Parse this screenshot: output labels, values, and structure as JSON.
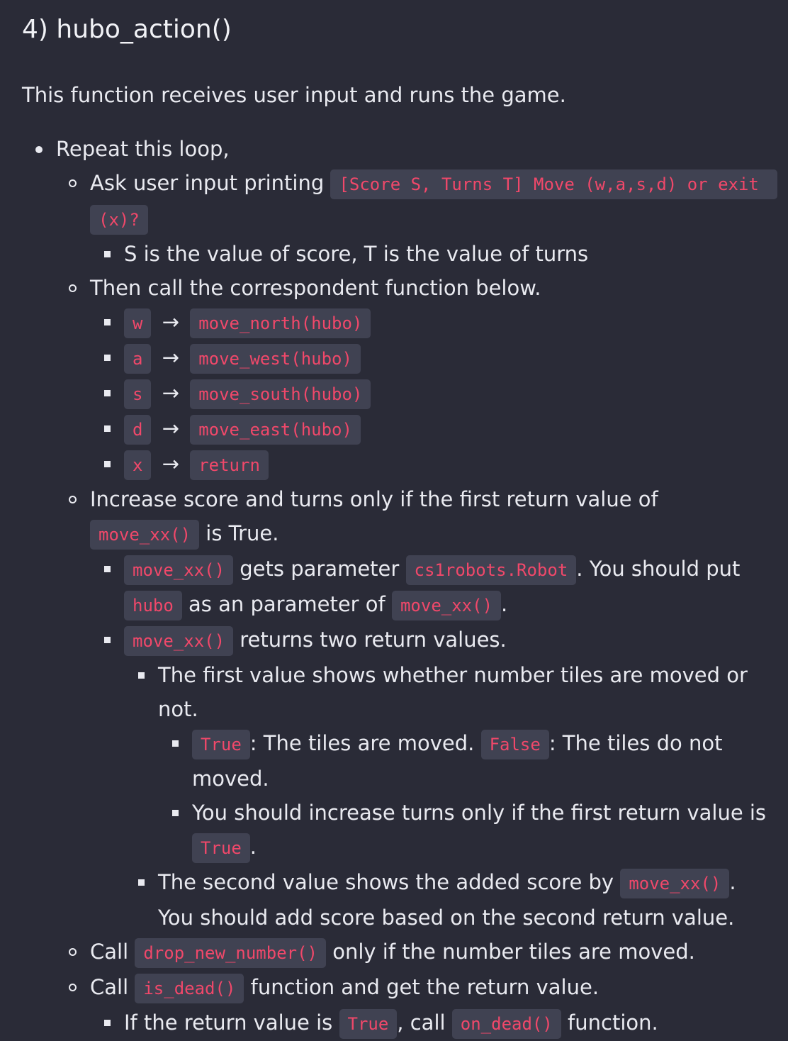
{
  "heading": "4) hubo_action()",
  "intro": "This function receives user input and runs the game.",
  "loop": {
    "label": "Repeat this loop,",
    "ask": {
      "text": "Ask user input printing ",
      "code": "[Score S, Turns T] Move (w,a,s,d) or exit (x)?",
      "note": "S is the value of score, T is the value of turns"
    },
    "call": {
      "text": "Then call the correspondent function below.",
      "arrow": "→",
      "mappings": [
        {
          "key": "w",
          "fn": "move_north(hubo)"
        },
        {
          "key": "a",
          "fn": "move_west(hubo)"
        },
        {
          "key": "s",
          "fn": "move_south(hubo)"
        },
        {
          "key": "d",
          "fn": "move_east(hubo)"
        },
        {
          "key": "x",
          "fn": "return"
        }
      ]
    },
    "increase": {
      "text_before": "Increase score and turns only if the first return value of ",
      "code": "move_xx()",
      "text_after": " is True.",
      "param": {
        "code1": "move_xx()",
        "t1": " gets parameter ",
        "code2": "cs1robots.Robot",
        "t2": ". You should put ",
        "code3": "hubo",
        "t3": " as an parameter of ",
        "code4": "move_xx()",
        "t4": "."
      },
      "returns": {
        "code": "move_xx()",
        "text": " returns two return values.",
        "first": {
          "text": "The first value shows whether number tiles are moved or not.",
          "truefalse": {
            "code_true": "True",
            "t1": ": The tiles are moved. ",
            "code_false": "False",
            "t2": ": The tiles do not moved."
          },
          "turns": {
            "text": "You should increase turns only if the first return value is ",
            "code": "True",
            "end": "."
          }
        },
        "second": {
          "text": "The second value shows the added score by ",
          "code": "move_xx()",
          "end": ". You should add score based on the second return value."
        }
      }
    },
    "drop": {
      "t1": "Call ",
      "code": "drop_new_number()",
      "t2": " only if the number tiles are moved."
    },
    "dead": {
      "t1": "Call ",
      "code": "is_dead()",
      "t2": " function and get the return value.",
      "sub": {
        "t1": "If the return value is ",
        "code1": "True",
        "t2": ", call ",
        "code2": "on_dead()",
        "t3": " function."
      }
    }
  }
}
